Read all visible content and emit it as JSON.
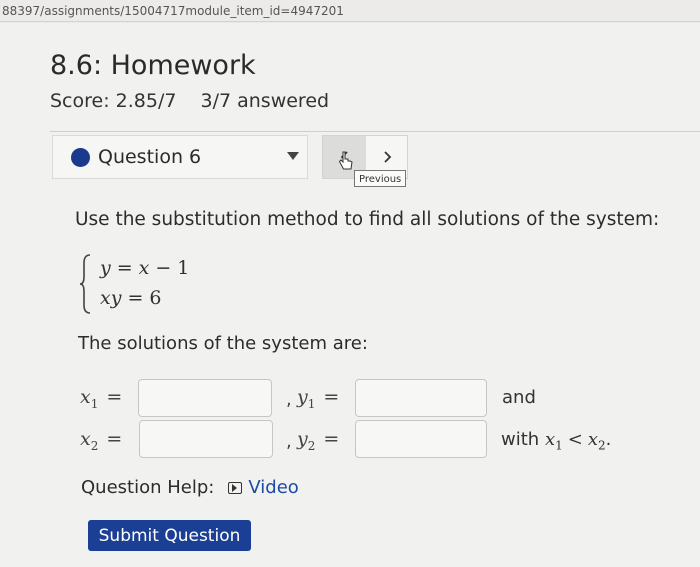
{
  "browser": {
    "url": "88397/assignments/15004717module_item_id=4947201"
  },
  "header": {
    "title": "8.6: Homework",
    "score": "Score: 2.85/7",
    "answered": "3/7 answered"
  },
  "question_nav": {
    "selected": "Question 6",
    "previous_tooltip": "Previous"
  },
  "problem": {
    "prompt": "Use the substitution method to find all solutions of the system:",
    "equations": [
      {
        "lhs": "y",
        "op": "=",
        "rhs_var": "x",
        "rhs_op": "−",
        "rhs_num": "1"
      },
      {
        "lhs": "xy",
        "op": "=",
        "rhs_num": "6"
      }
    ],
    "solutions_label": "The solutions of the system are:",
    "rows": [
      {
        "x_var": "x",
        "x_sub": "1",
        "y_var": "y",
        "y_sub": "1",
        "x_value": "",
        "y_value": "",
        "tail": "and"
      },
      {
        "x_var": "x",
        "x_sub": "2",
        "y_var": "y",
        "y_sub": "2",
        "x_value": "",
        "y_value": "",
        "tail_prefix": "with",
        "tail_lhs_sub": "1",
        "tail_op": "<",
        "tail_rhs_sub": "2",
        "tail_end": "."
      }
    ]
  },
  "help": {
    "label": "Question Help:",
    "video_label": "Video"
  },
  "submit": {
    "label": "Submit Question"
  },
  "colors": {
    "accent": "#1b3f94",
    "question_dot": "#1b3a8e"
  }
}
